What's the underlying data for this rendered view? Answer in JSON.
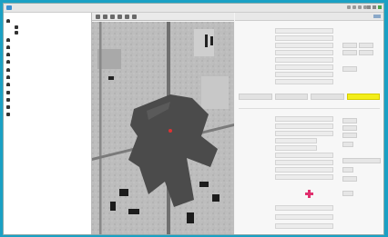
{
  "app": {
    "title": "",
    "accent": "#1aa0c4"
  },
  "tree": {
    "items": [
      {
        "label": "",
        "icon": "person-icon"
      },
      {
        "label": "",
        "icon": "folder-icon"
      },
      {
        "label": "",
        "icon": "folder-icon"
      },
      {
        "label": "",
        "icon": "person-icon"
      },
      {
        "label": "",
        "icon": "person-icon"
      },
      {
        "label": "",
        "icon": "person-icon"
      },
      {
        "label": "",
        "icon": "person-icon"
      },
      {
        "label": "",
        "icon": "person-icon"
      },
      {
        "label": "",
        "icon": "person-icon"
      },
      {
        "label": "",
        "icon": "person-icon"
      },
      {
        "label": "",
        "icon": "folder-icon"
      },
      {
        "label": "",
        "icon": "folder-icon"
      },
      {
        "label": "",
        "icon": "folder-icon"
      },
      {
        "label": "",
        "icon": "folder-icon"
      }
    ]
  },
  "panel": {
    "header": "",
    "tabs": [
      "",
      "",
      "",
      ""
    ],
    "active_tab_color": "#f3ee1a",
    "section": "",
    "marker_color": "#e0306e"
  }
}
